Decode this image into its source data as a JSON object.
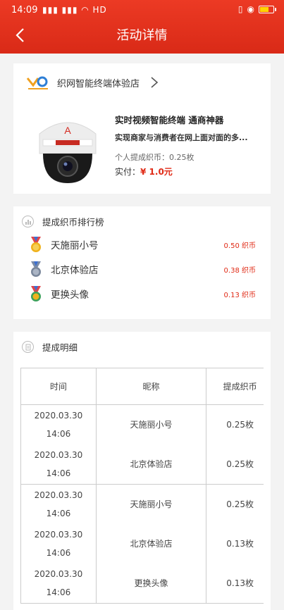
{
  "status_bar": {
    "time": "14:09",
    "signals": "📶📶 ≋ HD",
    "icons": "(|) ⏰"
  },
  "nav": {
    "title": "活动详情"
  },
  "shop": {
    "name": "织网智能终端体验店",
    "product": {
      "title": "实时视频智能终端 通商神器",
      "desc": "实现商家与消费者在网上面对面的多...",
      "commission": "个人提成织币：0.25枚",
      "pay_label": "实付：",
      "price": "¥ 1.0元"
    }
  },
  "rank": {
    "title": "提成织币排行榜",
    "items": [
      {
        "name": "天施丽小号",
        "value": "0.50 织币"
      },
      {
        "name": "北京体验店",
        "value": "0.38 织币"
      },
      {
        "name": "更换头像",
        "value": "0.13 织币"
      }
    ]
  },
  "detail": {
    "title": "提成明细",
    "headers": [
      "时间",
      "昵称",
      "提成织币"
    ],
    "groups": [
      {
        "rows": [
          {
            "date": "2020.03.30",
            "time": "14:06",
            "name": "天施丽小号",
            "amount": "0.25枚"
          },
          {
            "date": "2020.03.30",
            "time": "14:06",
            "name": "北京体验店",
            "amount": "0.25枚"
          }
        ]
      },
      {
        "rows": [
          {
            "date": "2020.03.30",
            "time": "14:06",
            "name": "天施丽小号",
            "amount": "0.25枚"
          },
          {
            "date": "2020.03.30",
            "time": "14:06",
            "name": "北京体验店",
            "amount": "0.13枚"
          },
          {
            "date": "2020.03.30",
            "time": "14:06",
            "name": "更换头像",
            "amount": "0.13枚"
          }
        ]
      }
    ]
  },
  "colors": {
    "header": "#e2301c",
    "accent": "#e02a15",
    "gold": "#f0b21c",
    "silver": "#8a96a8",
    "bronze": "#3da05a"
  }
}
